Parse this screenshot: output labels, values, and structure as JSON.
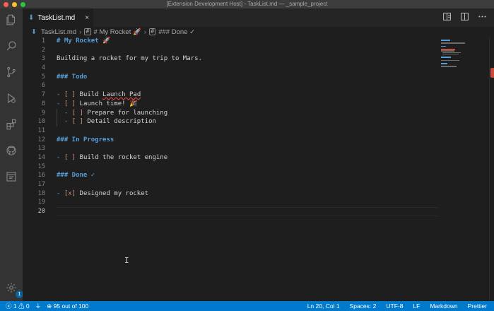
{
  "window": {
    "title": "[Extension Development Host] - TaskList.md — _sample_project"
  },
  "tab": {
    "label": "TaskList.md",
    "close_glyph": "×",
    "icon": "markdown-icon"
  },
  "breadcrumb": [
    {
      "label": "TaskList.md"
    },
    {
      "label": "# My Rocket 🚀"
    },
    {
      "label": "### Done ✓"
    }
  ],
  "editor": {
    "line_numbers": [
      "1",
      "2",
      "3",
      "4",
      "5",
      "6",
      "7",
      "8",
      "9",
      "10",
      "11",
      "12",
      "13",
      "14",
      "15",
      "16",
      "17",
      "18",
      "19",
      "20"
    ],
    "lines": [
      {
        "text": "# My Rocket 🚀",
        "kind": "heading"
      },
      {
        "text": "",
        "kind": "blank"
      },
      {
        "text": "Building a rocket for my trip to Mars.",
        "kind": "text"
      },
      {
        "text": "",
        "kind": "blank"
      },
      {
        "text": "### Todo",
        "kind": "heading"
      },
      {
        "text": "",
        "kind": "blank"
      },
      {
        "dash": "- ",
        "box": "[ ]",
        "rest": " Build ",
        "squiggle": "Launch Pad",
        "kind": "task"
      },
      {
        "dash": "- ",
        "box": "[ ]",
        "rest": " Launch time! 🎉",
        "kind": "task"
      },
      {
        "indent": "  ",
        "dash": "- ",
        "box": "[ ]",
        "rest": " Prepare for launching",
        "kind": "task"
      },
      {
        "indent": "  ",
        "dash": "- ",
        "box": "[ ]",
        "rest": " Detail description",
        "kind": "task"
      },
      {
        "text": "",
        "kind": "blank"
      },
      {
        "text": "### In Progress",
        "kind": "heading"
      },
      {
        "text": "",
        "kind": "blank"
      },
      {
        "dash": "- ",
        "box": "[ ]",
        "rest": " Build the rocket engine",
        "kind": "task"
      },
      {
        "text": "",
        "kind": "blank"
      },
      {
        "text": "### Done ✓",
        "kind": "heading"
      },
      {
        "text": "",
        "kind": "blank"
      },
      {
        "dash": "- ",
        "box": "[x]",
        "rest": " Designed my rocket",
        "kind": "task"
      },
      {
        "text": "",
        "kind": "blank"
      },
      {
        "text": "",
        "kind": "blank"
      }
    ],
    "current_line": 20
  },
  "statusbar": {
    "errors": "1",
    "warnings": "0",
    "progress": "95 out of 100",
    "position": "Ln 20, Col 1",
    "spaces": "Spaces: 2",
    "encoding": "UTF-8",
    "eol": "LF",
    "language": "Markdown",
    "formatter": "Prettier"
  },
  "activity": {
    "settings_badge": "1"
  },
  "colors": {
    "accent": "#007acc",
    "heading": "#569cd6",
    "checkbox": "#ce9178"
  }
}
